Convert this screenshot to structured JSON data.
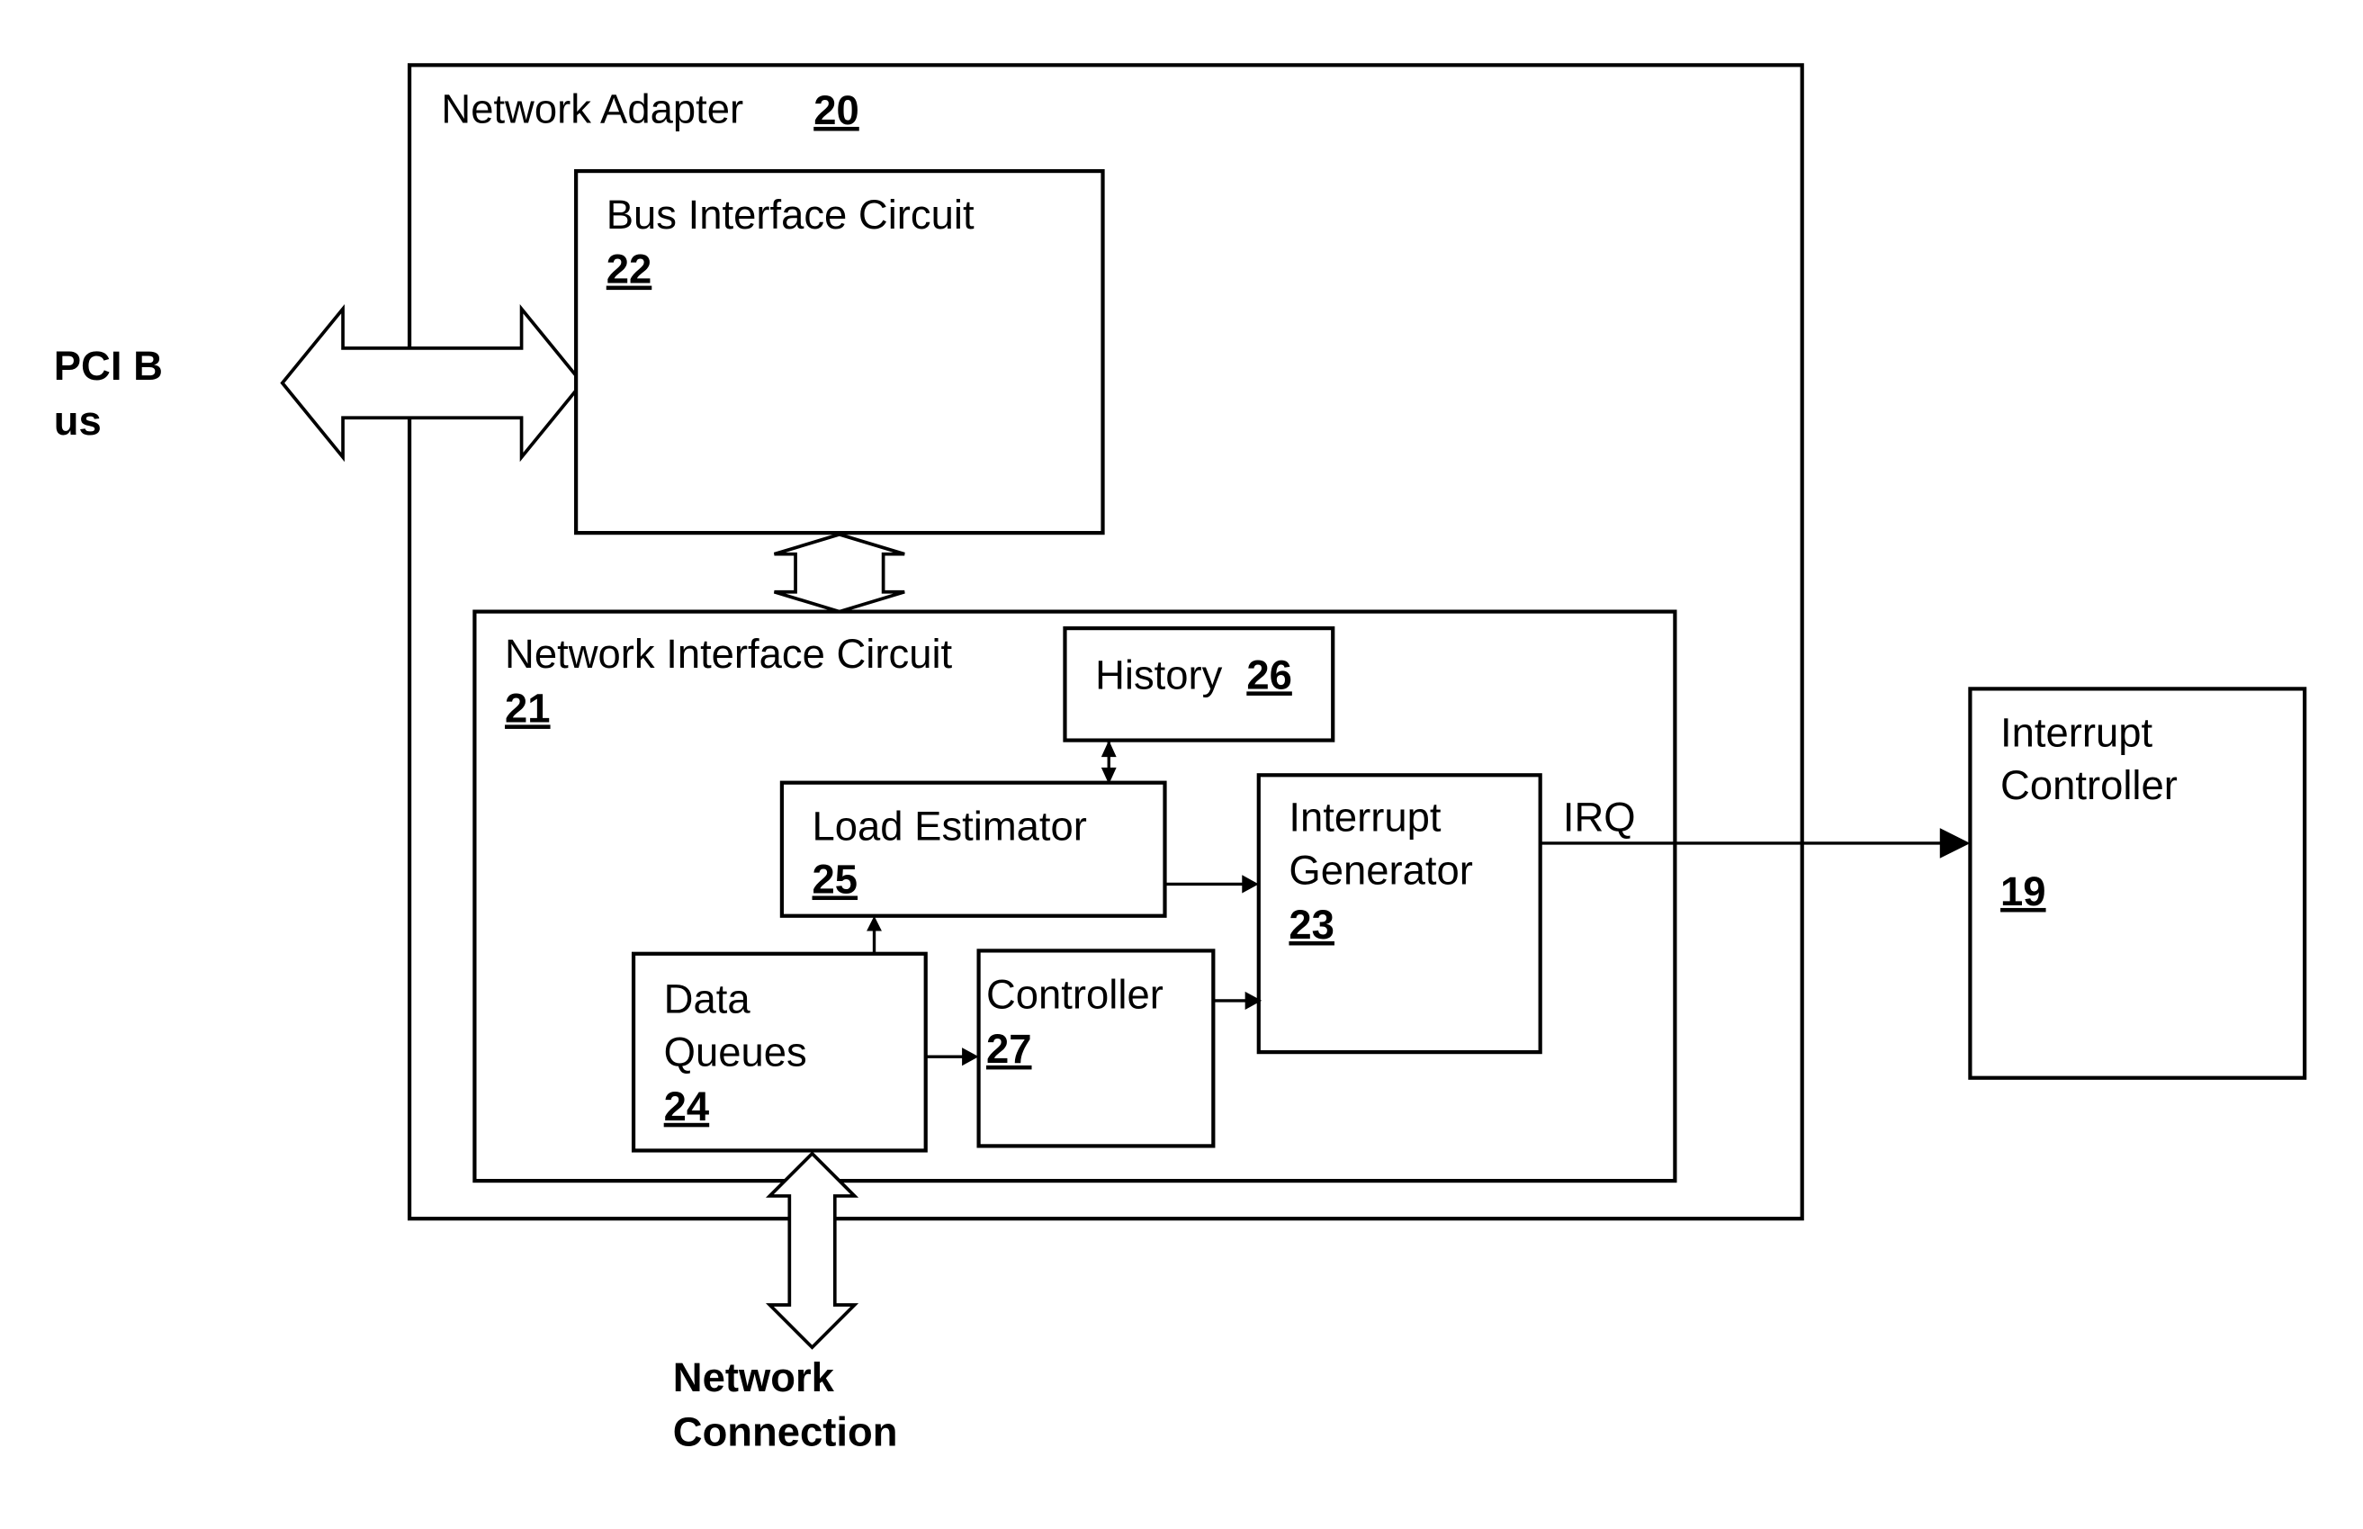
{
  "diagram": {
    "external": {
      "pci_bus_line1": "PCI B",
      "pci_bus_line2": "us",
      "network_connection_line1": "Network",
      "network_connection_line2": "Connection"
    },
    "network_adapter": {
      "label": "Network Adapter",
      "ref": "20"
    },
    "bus_interface_circuit": {
      "label": "Bus Interface Circuit",
      "ref": "22"
    },
    "network_interface_circuit": {
      "label": "Network Interface Circuit",
      "ref": "21"
    },
    "history": {
      "label": "History",
      "ref": "26"
    },
    "load_estimator": {
      "label": "Load Estimator",
      "ref": "25"
    },
    "interrupt_generator": {
      "label_line1": "Interrupt",
      "label_line2": "Generator",
      "ref": "23"
    },
    "data_queues": {
      "label_line1": "Data",
      "label_line2": "Queues",
      "ref": "24"
    },
    "controller": {
      "label": "Controller",
      "ref": "27"
    },
    "interrupt_controller": {
      "label_line1": "Interrupt",
      "label_line2": "Controller",
      "ref": "19"
    },
    "signals": {
      "irq": "IRQ"
    }
  }
}
